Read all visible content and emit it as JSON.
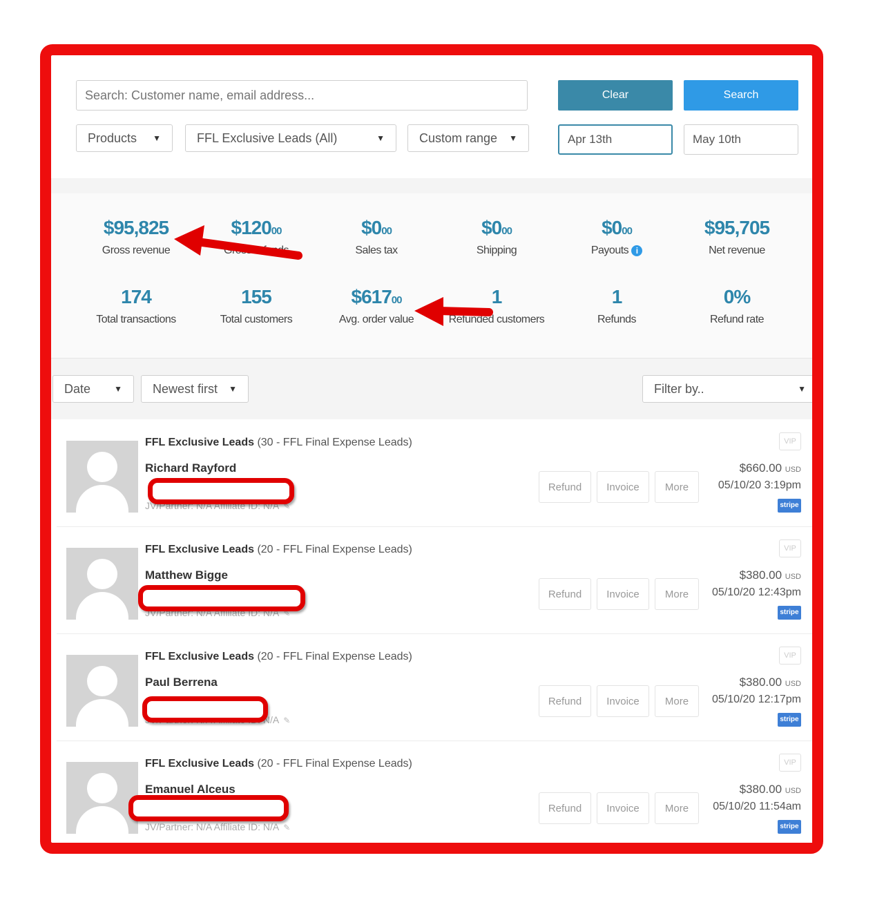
{
  "search": {
    "placeholder": "Search: Customer name, email address...",
    "clear_label": "Clear",
    "search_label": "Search"
  },
  "filters": {
    "products": "Products",
    "product_select": "FFL Exclusive Leads (All)",
    "range": "Custom range",
    "date_from": "Apr 13th",
    "date_to": "May 10th"
  },
  "stats": [
    {
      "value": "$95,825",
      "cents": "",
      "label": "Gross revenue"
    },
    {
      "value": "$120",
      "cents": "00",
      "label": "Gross refunds"
    },
    {
      "value": "$0",
      "cents": "00",
      "label": "Sales tax"
    },
    {
      "value": "$0",
      "cents": "00",
      "label": "Shipping"
    },
    {
      "value": "$0",
      "cents": "00",
      "label": "Payouts"
    },
    {
      "value": "$95,705",
      "cents": "",
      "label": "Net revenue"
    },
    {
      "value": "174",
      "cents": "",
      "label": "Total transactions"
    },
    {
      "value": "155",
      "cents": "",
      "label": "Total customers"
    },
    {
      "value": "$617",
      "cents": "00",
      "label": "Avg. order value"
    },
    {
      "value": "1",
      "cents": "",
      "label": "Refunded customers"
    },
    {
      "value": "1",
      "cents": "",
      "label": "Refunds"
    },
    {
      "value": "0%",
      "cents": "",
      "label": "Refund rate"
    }
  ],
  "payouts_info_icon": "i",
  "list_controls": {
    "sort_field": "Date",
    "sort_order": "Newest first",
    "filter": "Filter by.."
  },
  "actions": {
    "refund": "Refund",
    "invoice": "Invoice",
    "more": "More",
    "vip": "VIP",
    "stripe": "stripe"
  },
  "transactions": [
    {
      "product": "FFL Exclusive Leads",
      "detail": "(30 - FFL Final Expense Leads)",
      "name": "Richard Rayford",
      "partner": "JV/Partner: N/A  Affiliate ID: N/A",
      "amount": "$660.00",
      "currency": "USD",
      "datetime": "05/10/20 3:19pm"
    },
    {
      "product": "FFL Exclusive Leads",
      "detail": "(20 - FFL Final Expense Leads)",
      "name": "Matthew Bigge",
      "partner": "JV/Partner: N/A  Affiliate ID: N/A",
      "amount": "$380.00",
      "currency": "USD",
      "datetime": "05/10/20 12:43pm"
    },
    {
      "product": "FFL Exclusive Leads",
      "detail": "(20 - FFL Final Expense Leads)",
      "name": "Paul Berrena",
      "partner": "JV/Partner: N/A  Affiliate ID: N/A",
      "amount": "$380.00",
      "currency": "USD",
      "datetime": "05/10/20 12:17pm"
    },
    {
      "product": "FFL Exclusive Leads",
      "detail": "(20 - FFL Final Expense Leads)",
      "name": "Emanuel Alceus",
      "partner": "JV/Partner: N/A  Affiliate ID: N/A",
      "amount": "$380.00",
      "currency": "USD",
      "datetime": "05/10/20 11:54am"
    }
  ],
  "colors": {
    "frame": "#ee0d0d",
    "accent": "#2e86ab",
    "clear_button": "#3a89a8",
    "search_button": "#2f9ae6"
  }
}
